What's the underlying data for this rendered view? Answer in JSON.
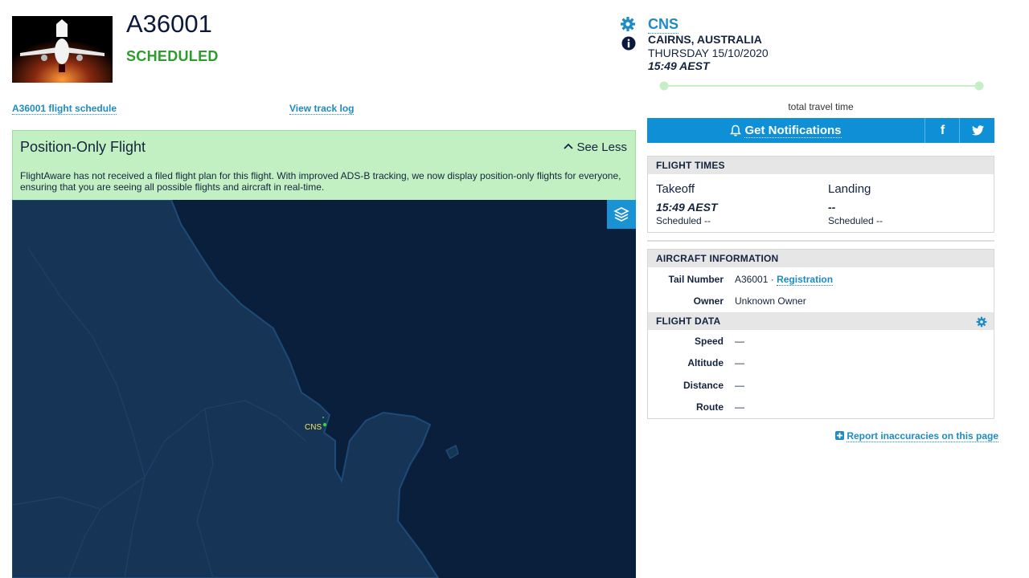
{
  "flight": {
    "ident": "A36001",
    "status": "SCHEDULED",
    "schedule_link": "A36001 flight schedule",
    "track_log_link": "View track log"
  },
  "banner": {
    "title": "Position-Only Flight",
    "see_less": "See Less",
    "description": "FlightAware has not received a filed flight plan for this flight. With improved ADS-B tracking, we now display position-only flights for everyone, ensuring that you are seeing all possible flights and aircraft in real-time."
  },
  "map": {
    "airport_label": "CNS"
  },
  "origin": {
    "code": "CNS",
    "city": "CAIRNS, AUSTRALIA",
    "date": "THURSDAY 15/10/2020",
    "time": "15:49 AEST"
  },
  "progress": {
    "label": "total travel time",
    "fraction": 0
  },
  "notifications": {
    "label": "Get Notifications"
  },
  "flight_times": {
    "header": "FLIGHT TIMES",
    "takeoff": {
      "label": "Takeoff",
      "time": "15:49 AEST",
      "scheduled": "Scheduled --"
    },
    "landing": {
      "label": "Landing",
      "time": "--",
      "scheduled": "Scheduled --"
    }
  },
  "aircraft": {
    "header": "AIRCRAFT INFORMATION",
    "tail_number_label": "Tail Number",
    "tail_number": "A36001",
    "separator": "·",
    "registration_link": "Registration",
    "owner_label": "Owner",
    "owner": "Unknown Owner"
  },
  "flight_data": {
    "header": "FLIGHT DATA",
    "rows": [
      {
        "label": "Speed",
        "value": "—"
      },
      {
        "label": "Altitude",
        "value": "—"
      },
      {
        "label": "Distance",
        "value": "—"
      },
      {
        "label": "Route",
        "value": "—"
      }
    ]
  },
  "report": {
    "label": "Report inaccuracies on this page"
  },
  "colors": {
    "accent": "#0e8fd6",
    "status_green": "#2a9d2a",
    "banner_green": "#c2f0c2",
    "map_water": "#0a1f3c",
    "map_land": "#163556"
  }
}
